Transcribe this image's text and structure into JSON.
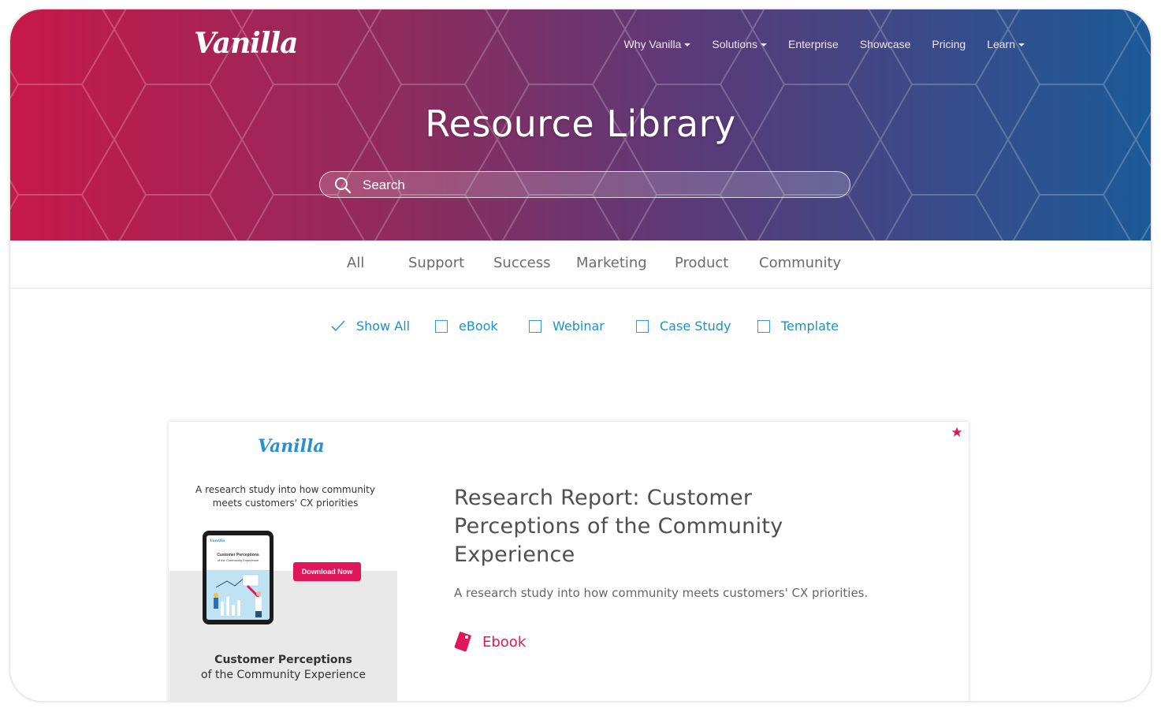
{
  "brand": {
    "logo_text": "Vanilla"
  },
  "nav": [
    {
      "label": "Why Vanilla",
      "has_dropdown": true
    },
    {
      "label": "Solutions",
      "has_dropdown": true
    },
    {
      "label": "Enterprise",
      "has_dropdown": false
    },
    {
      "label": "Showcase",
      "has_dropdown": false
    },
    {
      "label": "Pricing",
      "has_dropdown": false
    },
    {
      "label": "Learn",
      "has_dropdown": true
    }
  ],
  "hero": {
    "title": "Resource Library"
  },
  "search": {
    "placeholder": "Search",
    "value": ""
  },
  "tabs": [
    "All",
    "Support",
    "Success",
    "Marketing",
    "Product",
    "Community"
  ],
  "filters": [
    {
      "label": "Show All",
      "checked": true
    },
    {
      "label": "eBook",
      "checked": false
    },
    {
      "label": "Webinar",
      "checked": false
    },
    {
      "label": "Case Study",
      "checked": false
    },
    {
      "label": "Template",
      "checked": false
    }
  ],
  "card": {
    "thumbnail": {
      "logo_text": "Vanilla",
      "subtitle": "A research study into how community meets customers' CX priorities",
      "tablet_title": "Customer Perceptions",
      "tablet_subtitle": "of the Community Experience",
      "button_label": "Download Now",
      "caption_bold": "Customer Perceptions",
      "caption": "of the Community Experience"
    },
    "title": "Research Report: Customer Perceptions of the Community Experience",
    "description": "A research study into how community meets customers' CX priorities.",
    "tag": "Ebook",
    "featured_icon": "star-icon"
  },
  "colors": {
    "hero_gradient_start": "#c5194a",
    "hero_gradient_end": "#1d5a98",
    "accent_pink": "#e0165a",
    "filter_blue": "#1e8fc8"
  }
}
